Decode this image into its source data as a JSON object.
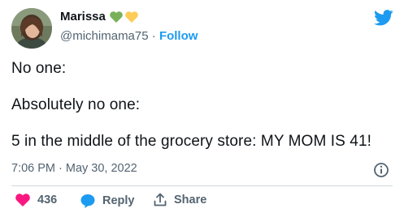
{
  "author": {
    "name": "Marissa",
    "name_emojis": [
      "green-heart",
      "yellow-heart"
    ],
    "handle": "@michimama75",
    "separator": " · ",
    "follow_label": "Follow"
  },
  "tweet": {
    "lines": [
      "No one:",
      "Absolutely no one:",
      "5 in the middle of the grocery store: MY MOM IS 41!"
    ],
    "timestamp": "7:06 PM · May 30, 2022"
  },
  "actions": {
    "like_count": "436",
    "reply_label": "Reply",
    "share_label": "Share"
  },
  "colors": {
    "accent": "#1d9bf0",
    "like": "#f91880",
    "muted": "#536471",
    "heart_green": "#78b159",
    "heart_yellow": "#fdcb58"
  }
}
